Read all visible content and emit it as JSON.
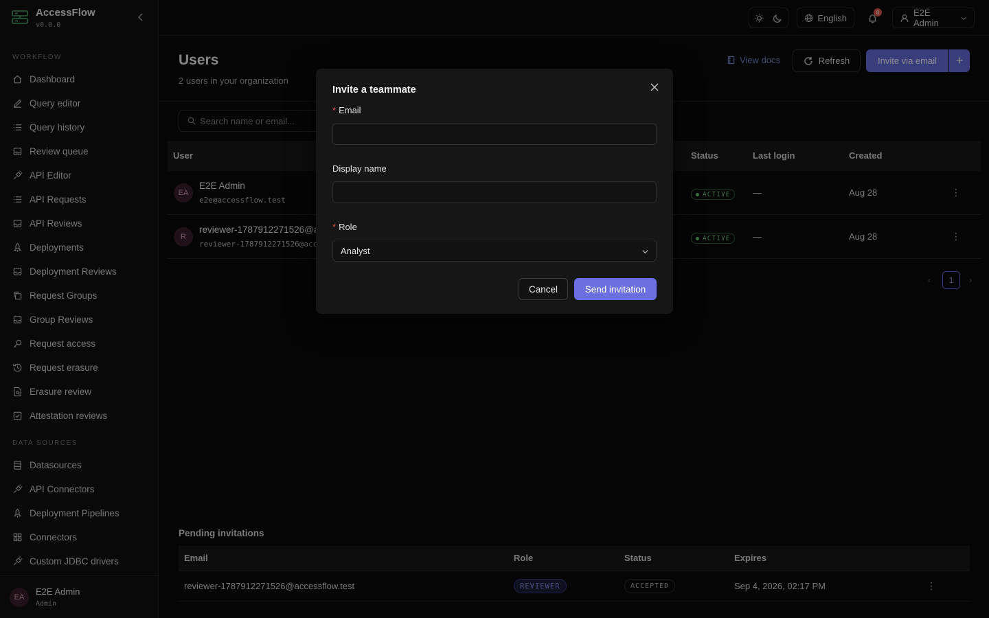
{
  "app": {
    "name": "AccessFlow",
    "version": "v0.0.0"
  },
  "sidebar": {
    "workflow_label": "WORKFLOW",
    "workflow_items": [
      {
        "label": "Dashboard",
        "icon": "home-icon"
      },
      {
        "label": "Query editor",
        "icon": "pencil-icon"
      },
      {
        "label": "Query history",
        "icon": "list-icon"
      },
      {
        "label": "Review queue",
        "icon": "inbox-icon"
      },
      {
        "label": "API Editor",
        "icon": "plug-icon"
      },
      {
        "label": "API Requests",
        "icon": "list-icon"
      },
      {
        "label": "API Reviews",
        "icon": "inbox-icon"
      },
      {
        "label": "Deployments",
        "icon": "rocket-icon"
      },
      {
        "label": "Deployment Reviews",
        "icon": "inbox-icon"
      },
      {
        "label": "Request Groups",
        "icon": "copy-icon"
      },
      {
        "label": "Group Reviews",
        "icon": "inbox-icon"
      },
      {
        "label": "Request access",
        "icon": "key-icon"
      },
      {
        "label": "Request erasure",
        "icon": "history-icon"
      },
      {
        "label": "Erasure review",
        "icon": "file-search-icon"
      },
      {
        "label": "Attestation reviews",
        "icon": "checkbox-icon"
      }
    ],
    "datasources_label": "DATA SOURCES",
    "datasource_items": [
      {
        "label": "Datasources",
        "icon": "database-icon"
      },
      {
        "label": "API Connectors",
        "icon": "plug-icon"
      },
      {
        "label": "Deployment Pipelines",
        "icon": "rocket-icon"
      },
      {
        "label": "Connectors",
        "icon": "grid-icon"
      },
      {
        "label": "Custom JDBC drivers",
        "icon": "plug-icon"
      }
    ],
    "user": {
      "initials": "EA",
      "name": "E2E Admin",
      "role": "Admin"
    }
  },
  "topbar": {
    "language": "English",
    "notification_count": "8",
    "user_label": "E2E Admin"
  },
  "page": {
    "title": "Users",
    "subtitle": "2 users in your organization",
    "view_docs": "View docs",
    "refresh": "Refresh",
    "invite": "Invite via email",
    "search_placeholder": "Search name or email...",
    "columns": {
      "user": "User",
      "status": "Status",
      "last_login": "Last login",
      "created": "Created"
    },
    "users": [
      {
        "initials": "EA",
        "name": "E2E Admin",
        "email": "e2e@accessflow.test",
        "status": "ACTIVE",
        "last_login": "—",
        "created": "Aug 28"
      },
      {
        "initials": "R",
        "name": "reviewer-1787912271526@ac",
        "email": "reviewer-1787912271526@acc",
        "status": "ACTIVE",
        "last_login": "—",
        "created": "Aug 28"
      }
    ],
    "current_page": "1"
  },
  "pending": {
    "title": "Pending invitations",
    "columns": {
      "email": "Email",
      "role": "Role",
      "status": "Status",
      "expires": "Expires"
    },
    "rows": [
      {
        "email": "reviewer-1787912271526@accessflow.test",
        "role": "REVIEWER",
        "status": "ACCEPTED",
        "expires": "Sep 4, 2026, 02:17 PM"
      }
    ]
  },
  "modal": {
    "title": "Invite a teammate",
    "email_label": "Email",
    "email_value": "",
    "display_name_label": "Display name",
    "display_name_value": "",
    "role_label": "Role",
    "role_value": "Analyst",
    "cancel": "Cancel",
    "send": "Send invitation"
  }
}
